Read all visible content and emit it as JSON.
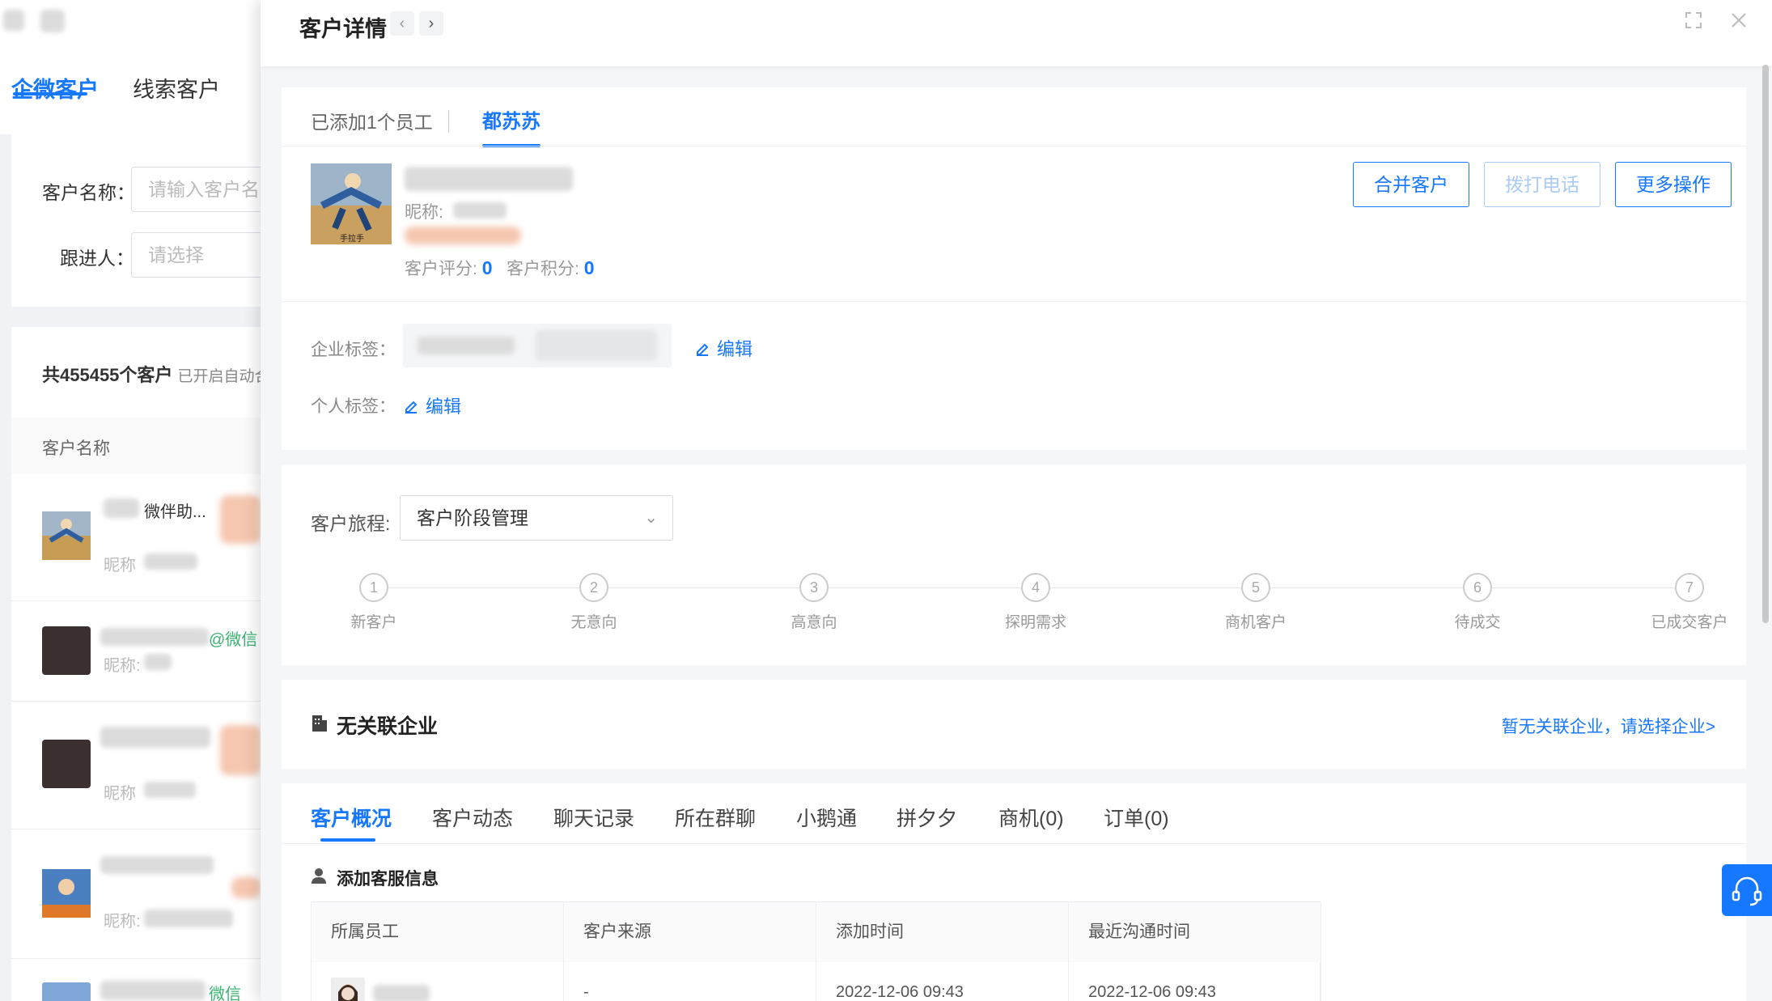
{
  "background": {
    "tabs": [
      "企微客户",
      "线索客户"
    ],
    "filters": {
      "customer_name_label": "客户名称：",
      "customer_name_placeholder": "请输入客户名称",
      "follower_label": "跟进人：",
      "follower_placeholder": "请选择"
    },
    "count_text": "共455455个客户",
    "count_note": "已开启自动合",
    "column_header": "客户名称",
    "rows": [
      {
        "name": "微伴助...",
        "nickname": "昵称"
      },
      {
        "name_suffix": "@微信",
        "nickname": "昵称:"
      },
      {
        "nickname": "昵称"
      },
      {
        "nickname": "昵称:"
      },
      {
        "name_suffix": "微信"
      }
    ]
  },
  "drawer": {
    "title": "客户详情",
    "nav_prev": "‹",
    "nav_next": "›",
    "employee_tabs": {
      "added": "已添加1个员工",
      "current": "都苏苏"
    },
    "profile": {
      "nickname_label": "昵称:",
      "score_label": "客户评分:",
      "score_value": "0",
      "points_label": "客户积分:",
      "points_value": "0"
    },
    "actions": {
      "merge": "合并客户",
      "call": "拨打电话",
      "more": "更多操作"
    },
    "tags": {
      "enterprise_label": "企业标签：",
      "personal_label": "个人标签：",
      "edit": "编辑"
    },
    "journey": {
      "label": "客户旅程:",
      "selected": "客户阶段管理",
      "steps": [
        {
          "num": "1",
          "label": "新客户"
        },
        {
          "num": "2",
          "label": "无意向"
        },
        {
          "num": "3",
          "label": "高意向"
        },
        {
          "num": "4",
          "label": "探明需求"
        },
        {
          "num": "5",
          "label": "商机客户"
        },
        {
          "num": "6",
          "label": "待成交"
        },
        {
          "num": "7",
          "label": "已成交客户"
        }
      ]
    },
    "company": {
      "title": "无关联企业",
      "link": "暂无关联企业，请选择企业>"
    },
    "info_tabs": [
      "客户概况",
      "客户动态",
      "聊天记录",
      "所在群聊",
      "小鹅通",
      "拼夕夕",
      "商机(0)",
      "订单(0)"
    ],
    "service_section": {
      "title": "添加客服信息",
      "columns": [
        "所属员工",
        "客户来源",
        "添加时间",
        "最近沟通时间"
      ],
      "rows": [
        {
          "source": "-",
          "added": "2022-12-06 09:43",
          "last_contact": "2022-12-06 09:43"
        }
      ]
    }
  }
}
